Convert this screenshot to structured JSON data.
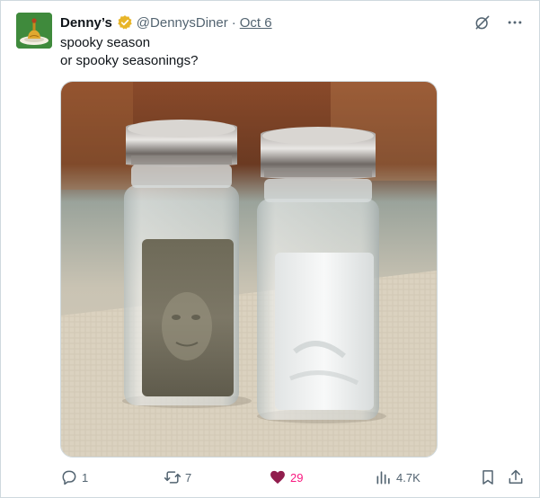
{
  "tweet": {
    "display_name": "Denny’s",
    "handle": "@DennysDiner",
    "separator": "·",
    "date": "Oct 6",
    "text_lines": [
      "spooky season",
      "or spooky seasonings?"
    ]
  },
  "actions": {
    "reply_count": "1",
    "retweet_count": "7",
    "like_count": "29",
    "view_count": "4.7K"
  },
  "icons": {
    "verified": "verified-badge-icon",
    "grok": "grok-icon",
    "more": "more-icon",
    "reply": "reply-icon",
    "retweet": "retweet-icon",
    "like": "heart-icon",
    "views": "views-icon",
    "bookmark": "bookmark-icon",
    "share": "share-icon"
  },
  "colors": {
    "text": "#0f1419",
    "muted": "#536471",
    "like": "#f91880",
    "border": "#cfd9de",
    "verified": "#e8b528"
  }
}
